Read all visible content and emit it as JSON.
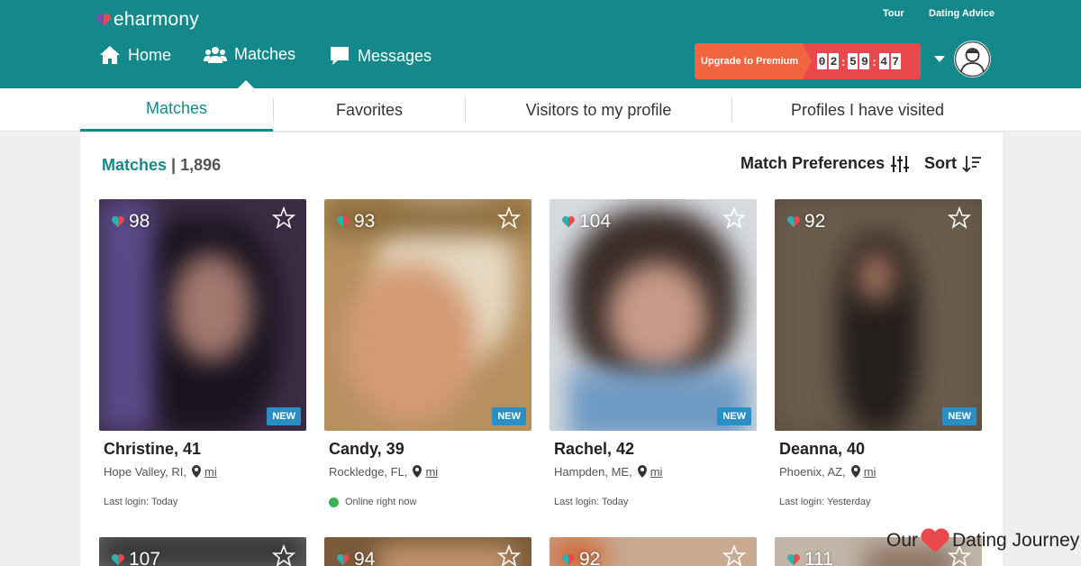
{
  "header": {
    "brand": "eharmony",
    "top_links": [
      "Tour",
      "Dating Advice"
    ],
    "nav": [
      {
        "label": "Home",
        "icon": "home-icon"
      },
      {
        "label": "Matches",
        "icon": "users-icon"
      },
      {
        "label": "Messages",
        "icon": "chat-icon"
      }
    ],
    "upgrade_label": "Upgrade to Premium",
    "timer_digits": [
      "0",
      "2",
      "5",
      "9",
      "4",
      "7"
    ],
    "colors": {
      "header_bg": "#14898c",
      "upgrade": "#f0643f",
      "timer": "#e9484d"
    }
  },
  "tabs": [
    "Matches",
    "Favorites",
    "Visitors to my profile",
    "Profiles I have visited"
  ],
  "summary": {
    "label": "Matches",
    "separator": "|",
    "count": "1,896"
  },
  "toolbar": {
    "preferences": "Match Preferences",
    "sort": "Sort"
  },
  "cards": [
    {
      "score": "98",
      "name": "Christine, 41",
      "location": "Hope Valley, RI,",
      "distance": "mi",
      "badge": "NEW",
      "status": "Last login: Today"
    },
    {
      "score": "93",
      "name": "Candy, 39",
      "location": "Rockledge, FL,",
      "distance": "mi",
      "badge": "NEW",
      "status": "Online right now"
    },
    {
      "score": "104",
      "name": "Rachel, 42",
      "location": "Hampden, ME,",
      "distance": "mi",
      "badge": "NEW",
      "status": "Last login: Today"
    },
    {
      "score": "92",
      "name": "Deanna, 40",
      "location": "Phoenix, AZ,",
      "distance": "mi",
      "badge": "NEW",
      "status": "Last login: Yesterday"
    }
  ],
  "second_row_scores": [
    "107",
    "94",
    "92",
    "111"
  ],
  "watermark": {
    "left": "Our",
    "right": "Dating Journey"
  }
}
